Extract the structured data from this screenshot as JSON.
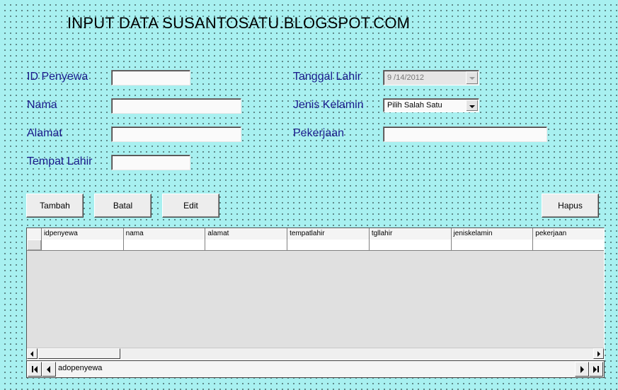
{
  "title": "INPUT DATA SUSANTOSATU.BLOGSPOT.COM",
  "labels": {
    "id_penyewa": "ID Penyewa",
    "nama": "Nama",
    "alamat": "Alamat",
    "tempat_lahir": "Tempat Lahir",
    "tanggal_lahir": "Tanggal Lahir",
    "jenis_kelamin": "Jenis Kelamin",
    "pekerjaan": "Pekerjaan"
  },
  "fields": {
    "id_penyewa": "",
    "nama": "",
    "alamat": "",
    "tempat_lahir": "",
    "tanggal_lahir": "9 /14/2012",
    "jenis_kelamin": "Pilih Salah Satu",
    "pekerjaan": ""
  },
  "buttons": {
    "tambah": "Tambah",
    "batal": "Batal",
    "edit": "Edit",
    "hapus": "Hapus"
  },
  "grid": {
    "columns": [
      "idpenyewa",
      "nama",
      "alamat",
      "tempatlahir",
      "tgllahir",
      "jeniskelamin",
      "pekerjaan"
    ]
  },
  "adodc": {
    "caption": "adopenyewa"
  }
}
